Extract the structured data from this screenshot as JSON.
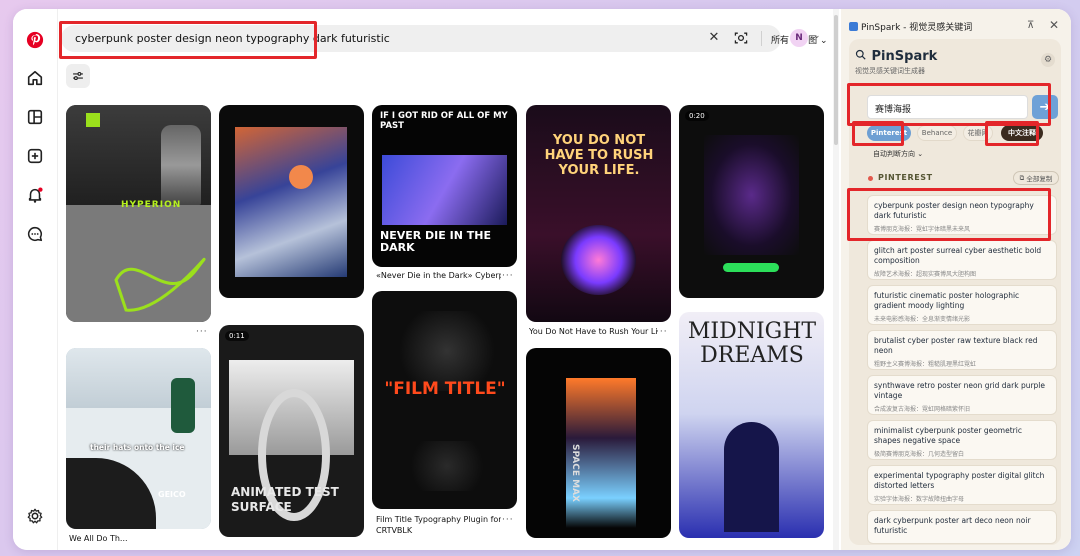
{
  "search": {
    "query": "cyberpunk poster design neon typography dark futuristic",
    "filter_label": "所有 Pin 图"
  },
  "user": {
    "avatar_initial": "N"
  },
  "pins": [
    {
      "title": "",
      "badge": ""
    },
    {
      "title": "",
      "badge": ""
    },
    {
      "title": "«Never Die in the Dark» Cyberpu...",
      "badge": ""
    },
    {
      "title": "You Do Not Have to Rush Your Life...",
      "badge": ""
    },
    {
      "title": "",
      "badge": "0:20"
    },
    {
      "title": "We All Do Th...",
      "badge": ""
    },
    {
      "title": "",
      "badge": "0:11"
    },
    {
      "title": "Film Title Typography Plugin for...",
      "subtitle": "CRTVBLK",
      "badge": ""
    },
    {
      "title": "",
      "badge": ""
    },
    {
      "title": "",
      "badge": ""
    }
  ],
  "pin_art": {
    "p3_top": "IF I GOT RID OF ALL OF MY PAST",
    "p3_bottom": "NEVER DIE IN THE DARK",
    "p4_text": "YOU DO NOT HAVE TO RUSH YOUR LIFE.",
    "p7_text": "ANIMATED TEST SURFACE",
    "p8_text": "\"FILM TITLE\"",
    "p9_text": "SPACE MAX",
    "p10_text": "MIDNIGHT DREAMS",
    "p1_text": "HYPERION",
    "p6_caption": "their hats onto the ice",
    "p6_brand": "GEICO"
  },
  "panel": {
    "window_title": "PinSpark - 视觉灵感关键词",
    "brand": "PinSpark",
    "brand_sub": "视觉灵感关键词生成器",
    "input_value": "赛博海报",
    "chips": [
      "Pinterest",
      "Behance",
      "花瓣网",
      "中文注释"
    ],
    "auto_dir": "自动判断方向",
    "section_title": "PINTEREST",
    "copy_all": "全部复制",
    "keywords": [
      {
        "en": "cyberpunk poster design neon typography dark futuristic",
        "zh": "赛博朋克海报：霓虹字体暗黑未来风"
      },
      {
        "en": "glitch art poster surreal cyber aesthetic bold composition",
        "zh": "故障艺术海报：超现实赛博风大胆构图"
      },
      {
        "en": "futuristic cinematic poster holographic gradient moody lighting",
        "zh": "未来电影感海报：全息渐变情绪光影"
      },
      {
        "en": "brutalist cyber poster raw texture black red neon",
        "zh": "粗野主义赛博海报：粗糙肌理黑红霓虹"
      },
      {
        "en": "synthwave retro poster neon grid dark purple vintage",
        "zh": "合成波复古海报：霓虹网格暗紫怀旧"
      },
      {
        "en": "minimalist cyberpunk poster geometric shapes negative space",
        "zh": "极简赛博朋克海报：几何造型留白"
      },
      {
        "en": "experimental typography poster digital glitch distorted letters",
        "zh": "实验字体海报：数字故障扭曲字母"
      },
      {
        "en": "dark cyberpunk poster art deco neon noir futuristic",
        "zh": ""
      }
    ]
  },
  "colors": {
    "pinterest_red": "#e60023",
    "highlight_red": "#e3262a",
    "accent_blue": "#6e9fd3",
    "panel_bg": "#f6f2ea"
  }
}
